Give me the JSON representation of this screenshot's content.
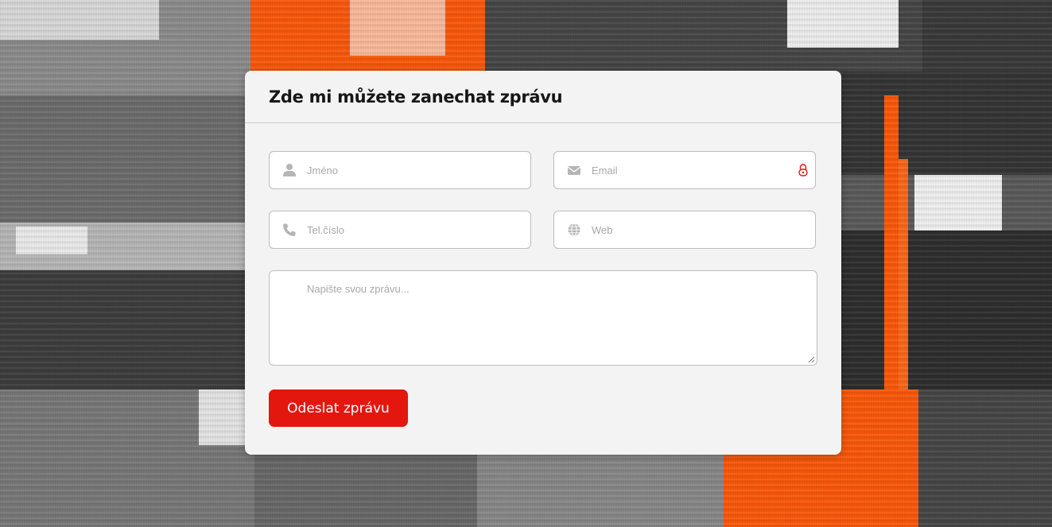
{
  "form": {
    "title": "Zde mi můžete zanechat zprávu",
    "name_placeholder": "Jméno",
    "email_placeholder": "Email",
    "phone_placeholder": "Tel.číslo",
    "web_placeholder": "Web",
    "message_placeholder": "Napište svou zprávu...",
    "submit_label": "Odeslat zprávu"
  },
  "colors": {
    "accent": "#e3170e",
    "card_bg": "#f3f3f3",
    "icon_gray": "#b5b5b5",
    "orange_paint": "#ff5a0a"
  },
  "icons": {
    "name": "user-icon",
    "email": "envelope-icon",
    "phone": "phone-icon",
    "web": "globe-icon",
    "password_manager": "lock-icon"
  }
}
